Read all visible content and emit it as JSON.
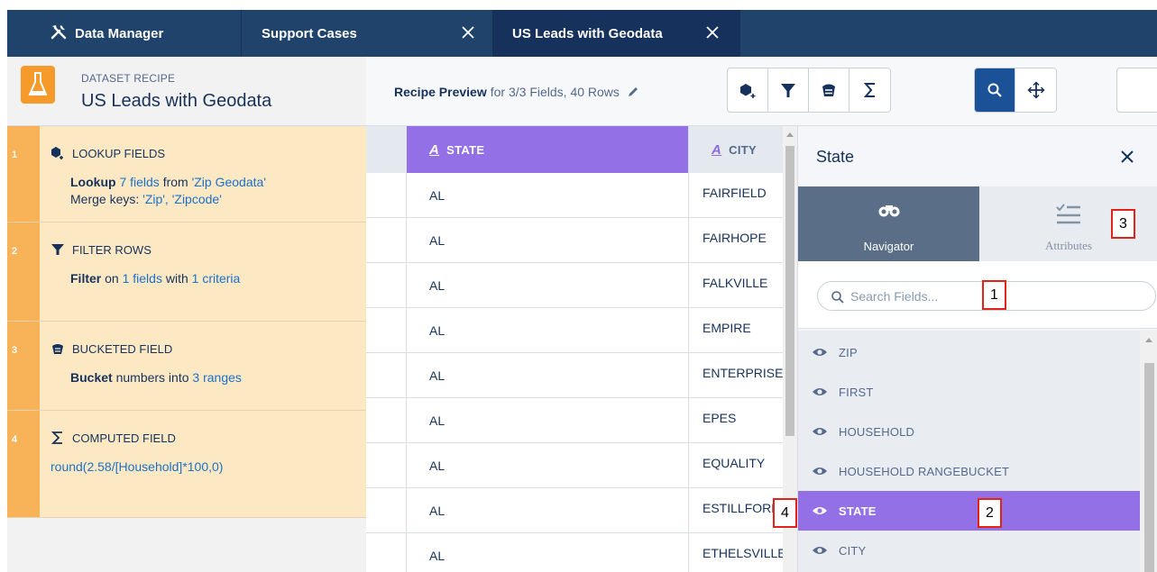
{
  "tabs": {
    "data_manager": "Data Manager",
    "support_cases": "Support Cases",
    "us_leads": "US Leads with Geodata"
  },
  "recipe": {
    "kicker": "DATASET RECIPE",
    "title": "US Leads with Geodata",
    "steps": [
      {
        "num": "1",
        "title": "LOOKUP FIELDS",
        "line1_bold": "Lookup",
        "line1_link": "7 fields",
        "line1_mid": "from",
        "line1_link2": "'Zip Geodata'",
        "line2_pre": "Merge keys:",
        "line2_link": "'Zip', 'Zipcode'"
      },
      {
        "num": "2",
        "title": "FILTER ROWS",
        "bold": "Filter",
        "pre": "on",
        "link1": "1 fields",
        "mid": "with",
        "link2": "1 criteria"
      },
      {
        "num": "3",
        "title": "BUCKETED FIELD",
        "bold": "Bucket",
        "pre": "numbers into",
        "link1": "3 ranges"
      },
      {
        "num": "4",
        "title": "COMPUTED FIELD",
        "link1": "round(2.58/[Household]*100,0)"
      }
    ]
  },
  "toolbar": {
    "preview_bold": "Recipe Preview",
    "preview_rest": "for 3/3 Fields, 40 Rows"
  },
  "grid": {
    "columns": [
      "STATE",
      "CITY"
    ],
    "rows": [
      {
        "state": "AL",
        "city": "FAIRFIELD"
      },
      {
        "state": "AL",
        "city": "FAIRHOPE"
      },
      {
        "state": "AL",
        "city": "FALKVILLE"
      },
      {
        "state": "AL",
        "city": "EMPIRE"
      },
      {
        "state": "AL",
        "city": "ENTERPRISE"
      },
      {
        "state": "AL",
        "city": "EPES"
      },
      {
        "state": "AL",
        "city": "EQUALITY"
      },
      {
        "state": "AL",
        "city": "ESTILLFORK"
      },
      {
        "state": "AL",
        "city": "ETHELSVILLE"
      }
    ]
  },
  "panel": {
    "title": "State",
    "tab_navigator": "Navigator",
    "tab_attributes": "Attributes",
    "search_placeholder": "Search Fields...",
    "fields": [
      "ZIP",
      "FIRST",
      "HOUSEHOLD",
      "HOUSEHOLD RANGEBUCKET",
      "STATE",
      "CITY"
    ],
    "selected_field": "STATE"
  },
  "callouts": [
    "1",
    "2",
    "3",
    "4"
  ],
  "colors": {
    "nav_bg": "#20436b",
    "accent_purple": "#9370e5",
    "step_bg": "#fde8c4",
    "step_num_bg": "#f8b257",
    "link": "#1b71c8",
    "active_button": "#1b5297"
  }
}
